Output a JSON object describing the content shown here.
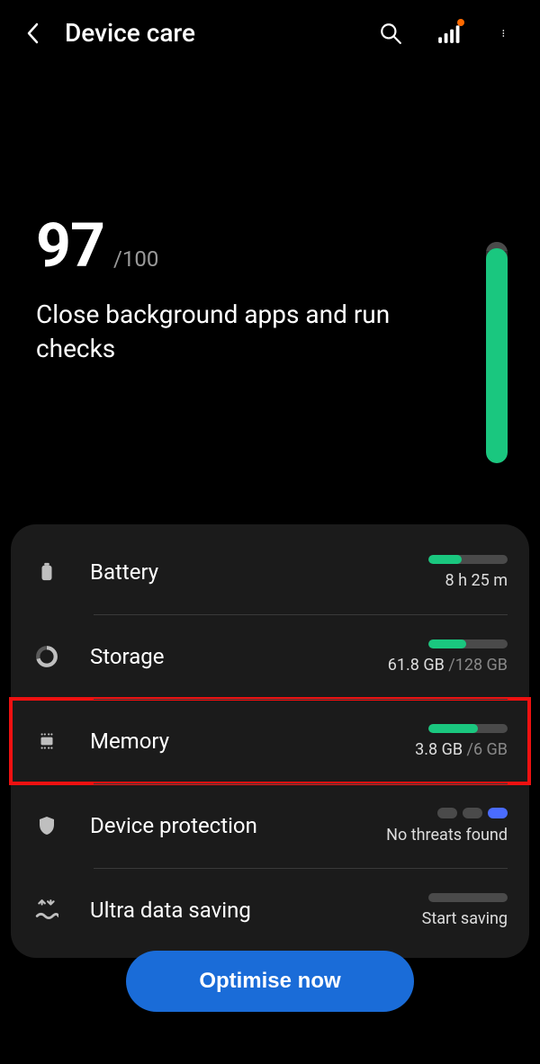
{
  "header": {
    "title": "Device care"
  },
  "score": {
    "value": "97",
    "total": "/100",
    "message": "Close background apps and run checks",
    "percent": 97
  },
  "rows": {
    "battery": {
      "label": "Battery",
      "detail": "8 h 25 m",
      "fill": 42
    },
    "storage": {
      "label": "Storage",
      "used": "61.8 GB ",
      "total": "/128 GB",
      "fill": 48
    },
    "memory": {
      "label": "Memory",
      "used": "3.8 GB ",
      "total": "/6 GB",
      "fill": 63
    },
    "protection": {
      "label": "Device protection",
      "detail": "No threats found"
    },
    "datasaving": {
      "label": "Ultra data saving",
      "detail": "Start saving"
    }
  },
  "button": {
    "label": "Optimise now"
  }
}
